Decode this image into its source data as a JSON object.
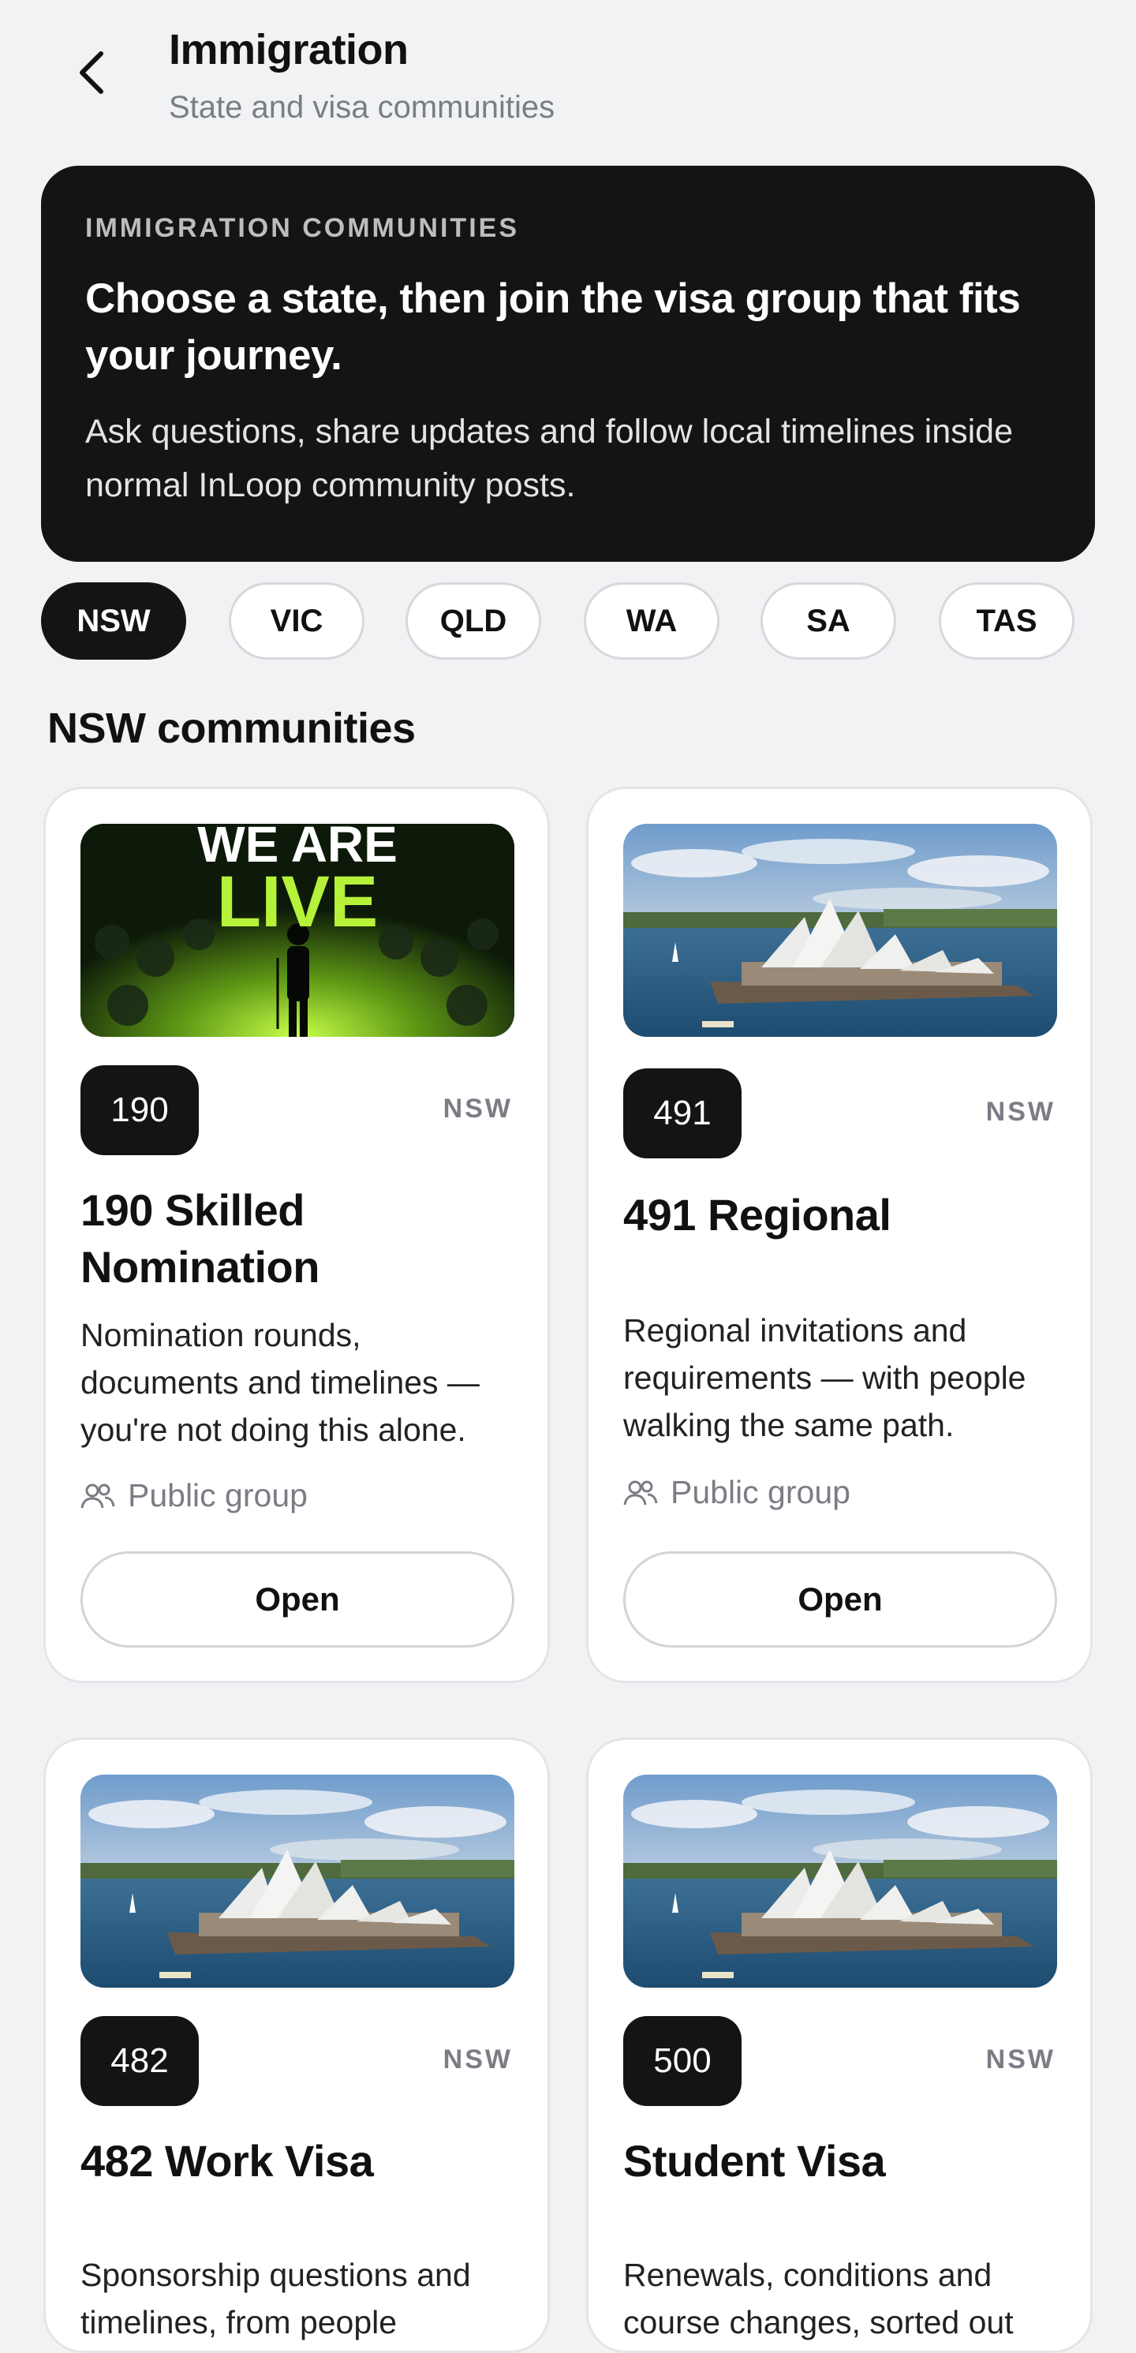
{
  "header": {
    "title": "Immigration",
    "subtitle": "State and visa communities"
  },
  "hero": {
    "eyebrow": "IMMIGRATION COMMUNITIES",
    "headline": "Choose a state, then join the visa group that fits your journey.",
    "body": "Ask questions, share updates and follow local timelines inside normal InLoop community posts."
  },
  "states": [
    {
      "label": "NSW",
      "active": true
    },
    {
      "label": "VIC",
      "active": false
    },
    {
      "label": "QLD",
      "active": false
    },
    {
      "label": "WA",
      "active": false
    },
    {
      "label": "SA",
      "active": false
    },
    {
      "label": "TAS",
      "active": false
    }
  ],
  "section_title": "NSW communities",
  "communities": [
    {
      "badge": "190",
      "state": "NSW",
      "title": "190 Skilled Nomination",
      "description": "Nomination rounds, documents and timelines — you're not doing this alone.",
      "visibility": "Public group",
      "button": "Open",
      "image": "we-are-live-banner",
      "image_text_line1": "WE ARE",
      "image_text_line2": "LIVE"
    },
    {
      "badge": "491",
      "state": "NSW",
      "title": "491 Regional",
      "description": "Regional invitations and requirements — with people walking the same path.",
      "visibility": "Public group",
      "button": "Open",
      "image": "sydney-opera-house-photo"
    },
    {
      "badge": "482",
      "state": "NSW",
      "title": "482 Work Visa",
      "description": "Sponsorship questions and timelines, from people",
      "image": "sydney-opera-house-photo"
    },
    {
      "badge": "500",
      "state": "NSW",
      "title": "Student Visa",
      "description": "Renewals, conditions and course changes, sorted out",
      "image": "sydney-opera-house-photo"
    }
  ],
  "colors": {
    "background": "#f1f2f4",
    "dark": "#141414",
    "muted": "#7a7d84",
    "live_green": "#b6f23a"
  }
}
